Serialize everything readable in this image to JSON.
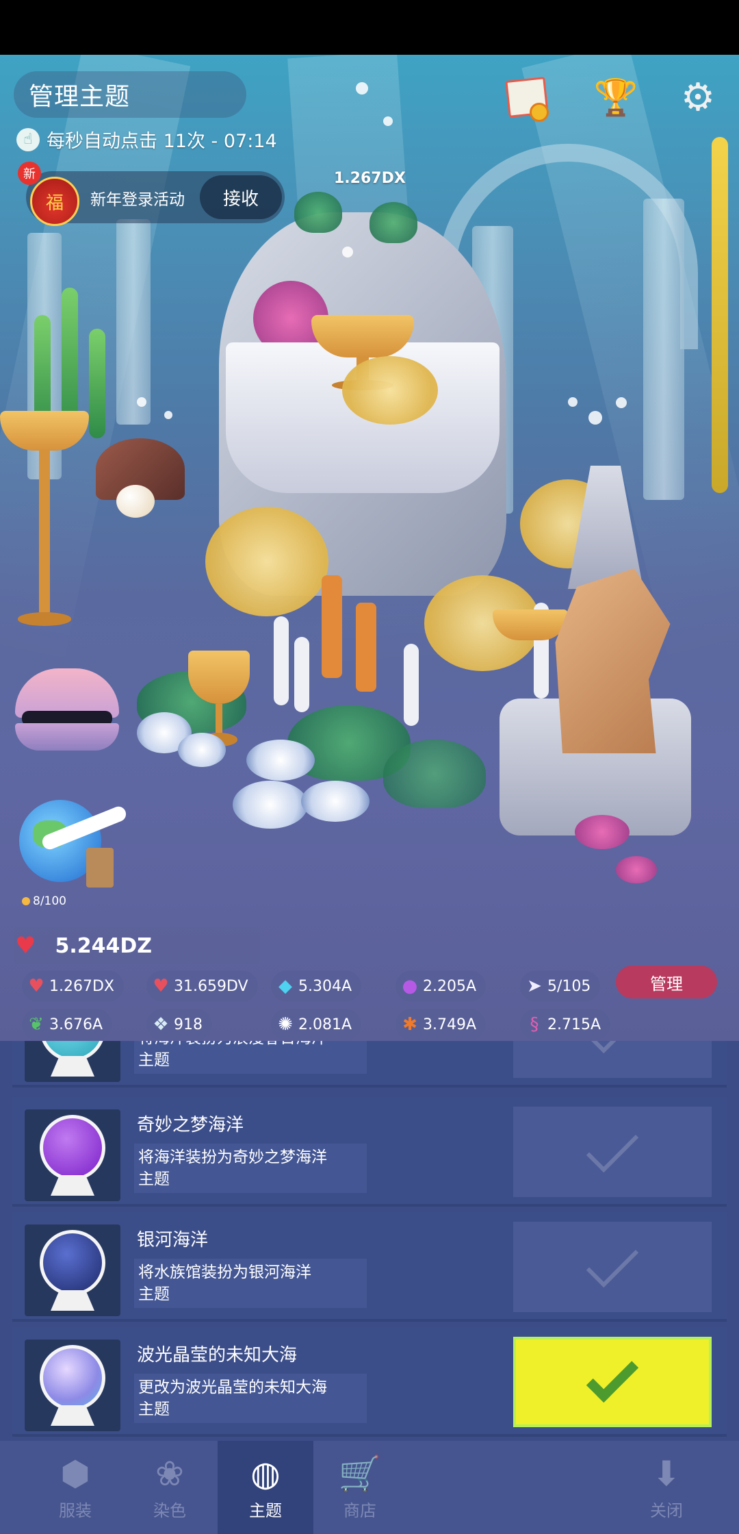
{
  "header": {
    "title": "管理主题",
    "auto_click": "每秒自动点击 11次 - 07:14",
    "new_badge": "新",
    "event_label": "新年登录活动",
    "event_button": "接收",
    "bag_glyph": "福",
    "click_value": "1.267DX"
  },
  "icons": {
    "album": "photo-album-icon",
    "trophy": "trophy-icon",
    "settings": "gear-icon"
  },
  "travel": {
    "count": "8/100"
  },
  "stats": {
    "love": "5.244DZ",
    "row1": [
      {
        "icon": "tap-heart-icon",
        "value": "1.267DX"
      },
      {
        "icon": "heart-plus-icon",
        "value": "31.659DV"
      },
      {
        "icon": "diamond-icon",
        "value": "5.304A"
      },
      {
        "icon": "pearl-icon",
        "value": "2.205A"
      },
      {
        "icon": "fish-icon",
        "value": "5/105"
      }
    ],
    "row2": [
      {
        "icon": "leaf-icon",
        "value": "3.676A"
      },
      {
        "icon": "crystal-icon",
        "value": "918"
      },
      {
        "icon": "urchin-icon",
        "value": "2.081A"
      },
      {
        "icon": "crab-icon",
        "value": "3.749A"
      },
      {
        "icon": "seahorse-icon",
        "value": "2.715A"
      }
    ],
    "manage_button": "管理"
  },
  "themes": [
    {
      "name": "",
      "desc_line1": "将海洋装扮为浪漫春日海洋",
      "desc_line2": "主题",
      "orb_color": "#2aa3b8",
      "selected": false
    },
    {
      "name": "奇妙之梦海洋",
      "desc_line1": "将海洋装扮为奇妙之梦海洋",
      "desc_line2": "主题",
      "orb_color": "#7a1fc9",
      "selected": false
    },
    {
      "name": "银河海洋",
      "desc_line1": "将水族馆装扮为银河海洋",
      "desc_line2": "主题",
      "orb_color": "#2e3d8f",
      "selected": false
    },
    {
      "name": "波光晶莹的未知大海",
      "desc_line1": "更改为波光晶莹的未知大海",
      "desc_line2": "主题",
      "orb_color": "#b3a8f0",
      "selected": true
    }
  ],
  "tabs": [
    {
      "label": "服装",
      "icon": "outfit-icon",
      "active": false
    },
    {
      "label": "染色",
      "icon": "coral-dye-icon",
      "active": false
    },
    {
      "label": "主题",
      "icon": "theme-icon",
      "active": true
    },
    {
      "label": "商店",
      "icon": "cart-icon",
      "active": false
    },
    {
      "label": "关闭",
      "icon": "close-down-icon",
      "active": false
    }
  ],
  "colors": {
    "accent_manage": "#b83a5e",
    "selected_check_bg": "#f0f02a",
    "list_bg": "#3b4c87"
  }
}
